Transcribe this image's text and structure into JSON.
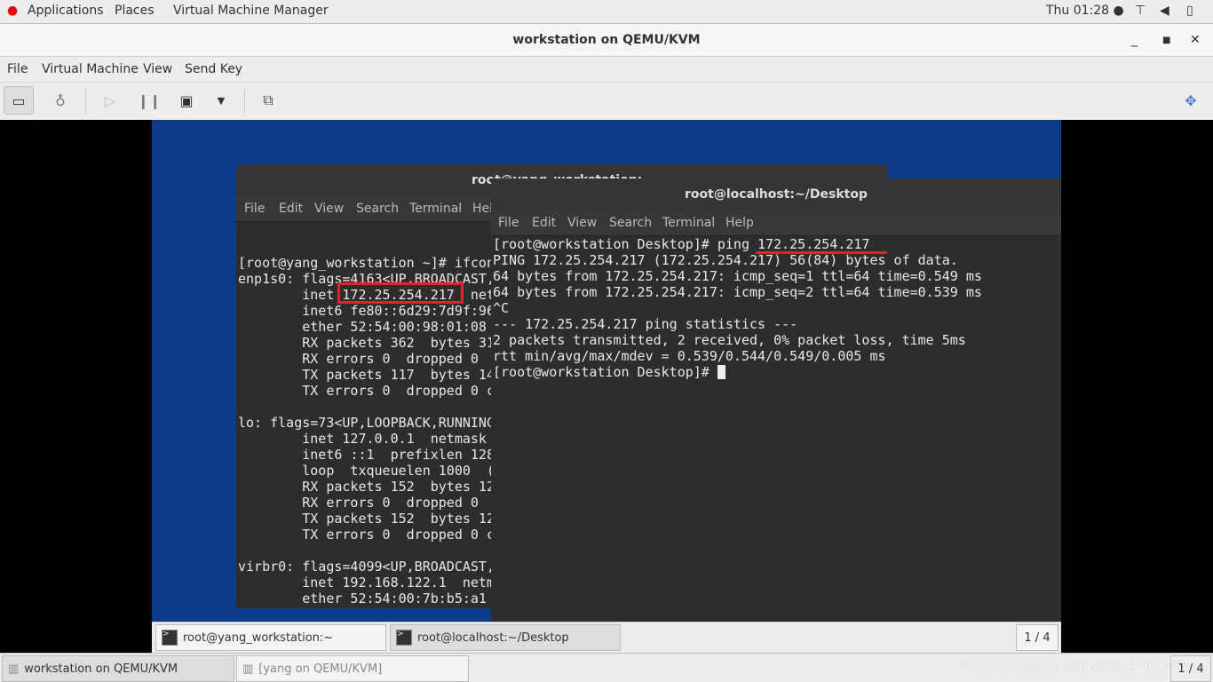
{
  "topbar": {
    "applications": "Applications",
    "places": "Places",
    "app": "Virtual Machine Manager",
    "clock": "Thu 01:28 ●"
  },
  "window": {
    "title": "workstation on QEMU/KVM"
  },
  "menu": [
    "File",
    "Virtual Machine",
    "View",
    "Send Key"
  ],
  "toolbar": {
    "icons": [
      "monitor-icon",
      "lightbulb-icon",
      "play-icon",
      "pause-icon",
      "power-icon",
      "dropdown-icon",
      "screenshot-icon",
      "fullscreen-icon"
    ]
  },
  "guest": {
    "term_back": {
      "title": "root@yang_workstation:~",
      "menu": [
        "File",
        "Edit",
        "View",
        "Search",
        "Terminal",
        "Help"
      ],
      "lines": [
        "",
        "[root@yang_workstation ~]# ifconfig",
        "enp1s0: flags=4163<UP,BROADCAST,",
        "        inet 172.25.254.217  netmask",
        "        inet6 fe80::6d29:7d9f:96",
        "        ether 52:54:00:98:01:08",
        "        RX packets 362  bytes 31",
        "        RX errors 0  dropped 0",
        "        TX packets 117  bytes 14",
        "        TX errors 0  dropped 0 c",
        "",
        "lo: flags=73<UP,LOOPBACK,RUNNING",
        "        inet 127.0.0.1  netmask",
        "        inet6 ::1  prefixlen 128",
        "        loop  txqueuelen 1000  (",
        "        RX packets 152  bytes 12",
        "        RX errors 0  dropped 0",
        "        TX packets 152  bytes 12",
        "        TX errors 0  dropped 0 c",
        "",
        "virbr0: flags=4099<UP,BROADCAST,",
        "        inet 192.168.122.1  netm",
        "        ether 52:54:00:7b:b5:a1"
      ]
    },
    "term_front": {
      "title": "root@localhost:~/Desktop",
      "menu": [
        "File",
        "Edit",
        "View",
        "Search",
        "Terminal",
        "Help"
      ],
      "lines": [
        "[root@workstation Desktop]# ping 172.25.254.217",
        "PING 172.25.254.217 (172.25.254.217) 56(84) bytes of data.",
        "64 bytes from 172.25.254.217: icmp_seq=1 ttl=64 time=0.549 ms",
        "64 bytes from 172.25.254.217: icmp_seq=2 ttl=64 time=0.539 ms",
        "^C",
        "--- 172.25.254.217 ping statistics ---",
        "2 packets transmitted, 2 received, 0% packet loss, time 5ms",
        "rtt min/avg/max/mdev = 0.539/0.544/0.549/0.005 ms",
        "[root@workstation Desktop]# "
      ]
    },
    "panel": {
      "tasks": [
        "root@yang_workstation:~",
        "root@localhost:~/Desktop"
      ],
      "workspace": "1 / 4"
    }
  },
  "host_taskbar": {
    "tasks": [
      "workstation on QEMU/KVM",
      "[yang on QEMU/KVM]"
    ],
    "watermark": "https://blog.csdn.net/weixin_42006882",
    "workspace": "1 / 4"
  },
  "colors": {
    "highlight": "#e8202a",
    "guest_bg": "#0c3b8c"
  }
}
